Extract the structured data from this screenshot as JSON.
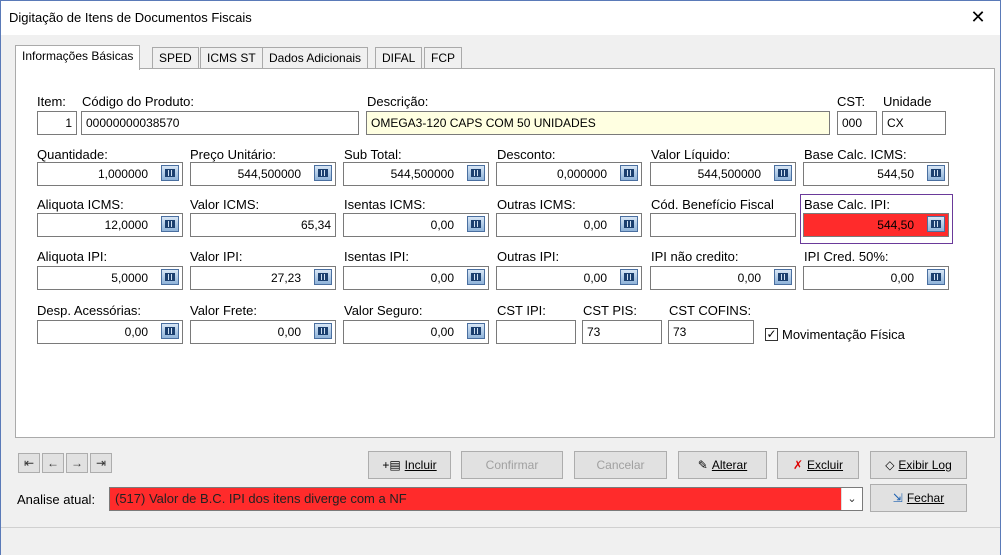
{
  "window": {
    "title": "Digitação de Itens de Documentos Fiscais",
    "close_label": "✕"
  },
  "tabs": [
    "Informações Básicas",
    "SPED",
    "ICMS ST",
    "Dados Adicionais",
    "DIFAL",
    "FCP"
  ],
  "form": {
    "item": {
      "label": "Item:",
      "value": "1"
    },
    "codigo": {
      "label": "Código do Produto:",
      "value": "00000000038570"
    },
    "descricao": {
      "label": "Descrição:",
      "value": "OMEGA3-120 CAPS COM 50 UNIDADES"
    },
    "cst": {
      "label": "CST:",
      "value": "000"
    },
    "unidade": {
      "label": "Unidade",
      "value": "CX"
    },
    "quantidade": {
      "label": "Quantidade:",
      "value": "1,000000"
    },
    "preco_unitario": {
      "label": "Preço Unitário:",
      "value": "544,500000"
    },
    "sub_total": {
      "label": "Sub Total:",
      "value": "544,500000"
    },
    "desconto": {
      "label": "Desconto:",
      "value": "0,000000"
    },
    "valor_liquido": {
      "label": "Valor Líquido:",
      "value": "544,500000"
    },
    "base_calc_icms": {
      "label": "Base Calc. ICMS:",
      "value": "544,50"
    },
    "aliquota_icms": {
      "label": "Aliquota ICMS:",
      "value": "12,0000"
    },
    "valor_icms": {
      "label": "Valor ICMS:",
      "value": "65,34"
    },
    "isentas_icms": {
      "label": "Isentas ICMS:",
      "value": "0,00"
    },
    "outras_icms": {
      "label": "Outras ICMS:",
      "value": "0,00"
    },
    "cod_beneficio": {
      "label": "Cód. Benefício Fiscal",
      "value": ""
    },
    "base_calc_ipi": {
      "label": "Base Calc. IPI:",
      "value": "544,50"
    },
    "aliquota_ipi": {
      "label": "Aliquota IPI:",
      "value": "5,0000"
    },
    "valor_ipi": {
      "label": "Valor IPI:",
      "value": "27,23"
    },
    "isentas_ipi": {
      "label": "Isentas IPI:",
      "value": "0,00"
    },
    "outras_ipi": {
      "label": "Outras IPI:",
      "value": "0,00"
    },
    "ipi_nao_credito": {
      "label": "IPI não credito:",
      "value": "0,00"
    },
    "ipi_cred_50": {
      "label": "IPI Cred. 50%:",
      "value": "0,00"
    },
    "desp_acessorias": {
      "label": "Desp. Acessórias:",
      "value": "0,00"
    },
    "valor_frete": {
      "label": "Valor Frete:",
      "value": "0,00"
    },
    "valor_seguro": {
      "label": "Valor Seguro:",
      "value": "0,00"
    },
    "cst_ipi": {
      "label": "CST IPI:",
      "value": ""
    },
    "cst_pis": {
      "label": "CST PIS:",
      "value": "73"
    },
    "cst_cofins": {
      "label": "CST COFINS:",
      "value": "73"
    },
    "mov_fisica": {
      "label": "Movimentação Física",
      "checked": true
    }
  },
  "buttons": {
    "incluir": "Incluir",
    "confirmar": "Confirmar",
    "cancelar": "Cancelar",
    "alterar": "Alterar",
    "excluir": "Excluir",
    "exibir_log": "Exibir Log",
    "fechar": "Fechar"
  },
  "analise": {
    "label": "Analise atual:",
    "value": "(517) Valor de B.C. IPI dos itens diverge com a NF"
  },
  "colors": {
    "error": "#ff2b2b",
    "description_bg": "#ffffe1",
    "focus_border": "#6a3a9a"
  }
}
